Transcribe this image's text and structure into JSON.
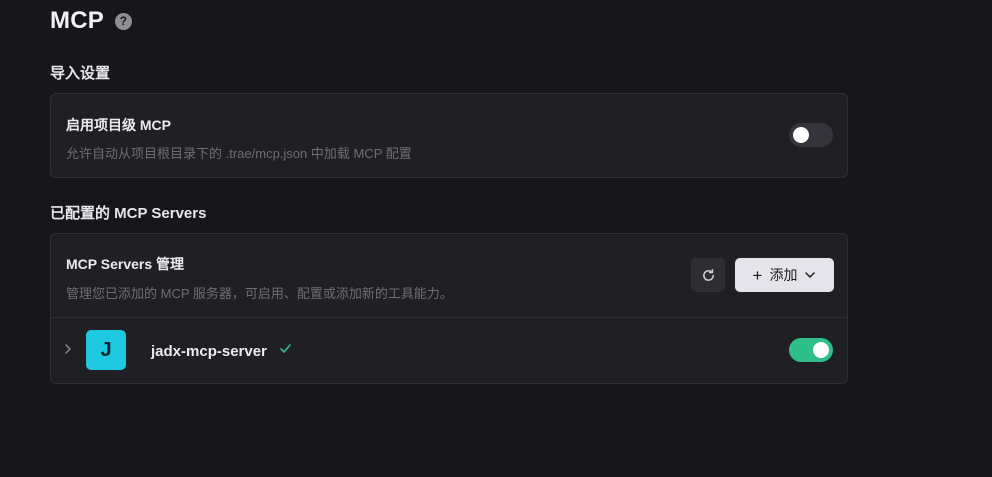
{
  "header": {
    "title": "MCP",
    "help_icon": "question-circle-icon",
    "help_glyph": "?"
  },
  "import_settings": {
    "heading": "导入设置",
    "project_mcp": {
      "title": "启用项目级 MCP",
      "description": "允许自动从项目根目录下的 .trae/mcp.json 中加载 MCP 配置",
      "enabled": false
    }
  },
  "configured_servers": {
    "heading": "已配置的 MCP Servers",
    "management": {
      "title": "MCP Servers 管理",
      "description": "管理您已添加的 MCP 服务器，可启用、配置或添加新的工具能力。",
      "refresh_icon": "refresh-icon",
      "add_label": "添加",
      "add_icon": "plus-icon",
      "add_dropdown_icon": "chevron-down-icon"
    },
    "servers": [
      {
        "avatar_letter": "J",
        "avatar_color": "#1ec8e0",
        "name": "jadx-mcp-server",
        "status_icon": "check-icon",
        "status_color": "#2fbf8a",
        "enabled": true
      }
    ]
  },
  "colors": {
    "background": "#17171a",
    "card": "#202024",
    "toggle_on": "#2fbf8a",
    "toggle_off": "#34343a",
    "add_button_bg": "#e4e4ea"
  }
}
